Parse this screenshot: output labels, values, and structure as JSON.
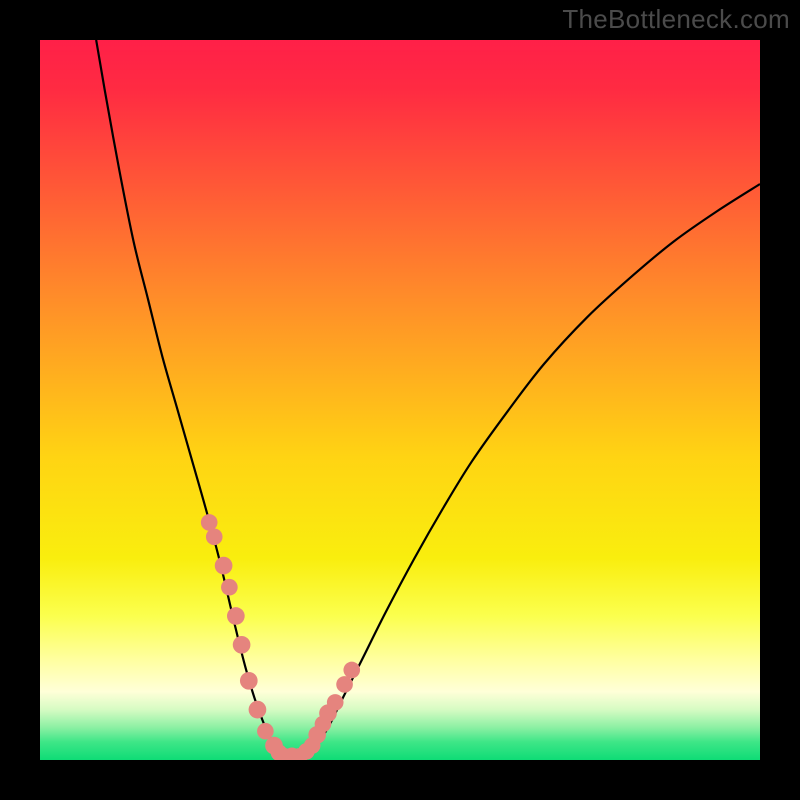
{
  "watermark": "TheBottleneck.com",
  "chart_data": {
    "type": "line",
    "title": "",
    "xlabel": "",
    "ylabel": "",
    "xlim": [
      0,
      100
    ],
    "ylim": [
      0,
      100
    ],
    "grid": false,
    "legend": false,
    "background_gradient": {
      "stops": [
        {
          "pos": 0.0,
          "color": "#ff2048"
        },
        {
          "pos": 0.07,
          "color": "#ff2b42"
        },
        {
          "pos": 0.35,
          "color": "#ff8a2a"
        },
        {
          "pos": 0.58,
          "color": "#ffd413"
        },
        {
          "pos": 0.72,
          "color": "#f9ee0e"
        },
        {
          "pos": 0.8,
          "color": "#fbff4e"
        },
        {
          "pos": 0.86,
          "color": "#ffff9f"
        },
        {
          "pos": 0.905,
          "color": "#ffffd8"
        },
        {
          "pos": 0.93,
          "color": "#d6fbc3"
        },
        {
          "pos": 0.955,
          "color": "#8bf0a3"
        },
        {
          "pos": 0.975,
          "color": "#3ee687"
        },
        {
          "pos": 1.0,
          "color": "#0edc76"
        }
      ]
    },
    "series": [
      {
        "name": "bottleneck-curve",
        "stroke": "#000000",
        "x": [
          7.8,
          9,
          11,
          13,
          15,
          17,
          19,
          21,
          23,
          25,
          27,
          28.5,
          30,
          32,
          34,
          36,
          38,
          40,
          42,
          45,
          48,
          52,
          56,
          60,
          65,
          70,
          76,
          82,
          88,
          94,
          100
        ],
        "y": [
          100,
          93,
          82,
          72,
          64,
          56,
          49,
          42,
          35,
          27.5,
          19,
          13,
          8,
          3,
          0.5,
          0.3,
          1.5,
          4.5,
          8.5,
          14.5,
          20.5,
          28,
          35,
          41.5,
          48.5,
          55,
          61.5,
          67,
          72,
          76.2,
          80
        ]
      }
    ],
    "markers": {
      "name": "highlighted-points",
      "color": "#e5847e",
      "x": [
        23.5,
        24.2,
        25.5,
        26.3,
        27.2,
        28.0,
        29.0,
        30.2,
        31.3,
        32.5,
        33.2,
        34.0,
        35.0,
        36.0,
        37.0,
        37.8,
        38.5,
        39.3,
        40.0,
        41.0,
        42.3,
        43.3
      ],
      "y": [
        33,
        31,
        27,
        24,
        20,
        16,
        11,
        7,
        4,
        2,
        1,
        0.5,
        0.5,
        0.5,
        1.2,
        2,
        3.5,
        5,
        6.5,
        8,
        10.5,
        12.5
      ],
      "r": [
        3.2,
        3.2,
        3.4,
        3.2,
        3.4,
        3.4,
        3.4,
        3.4,
        3.2,
        3.4,
        3.2,
        3.2,
        3.4,
        3.2,
        3.2,
        3.2,
        3.4,
        3.2,
        3.4,
        3.2,
        3.2,
        3.2
      ]
    }
  }
}
